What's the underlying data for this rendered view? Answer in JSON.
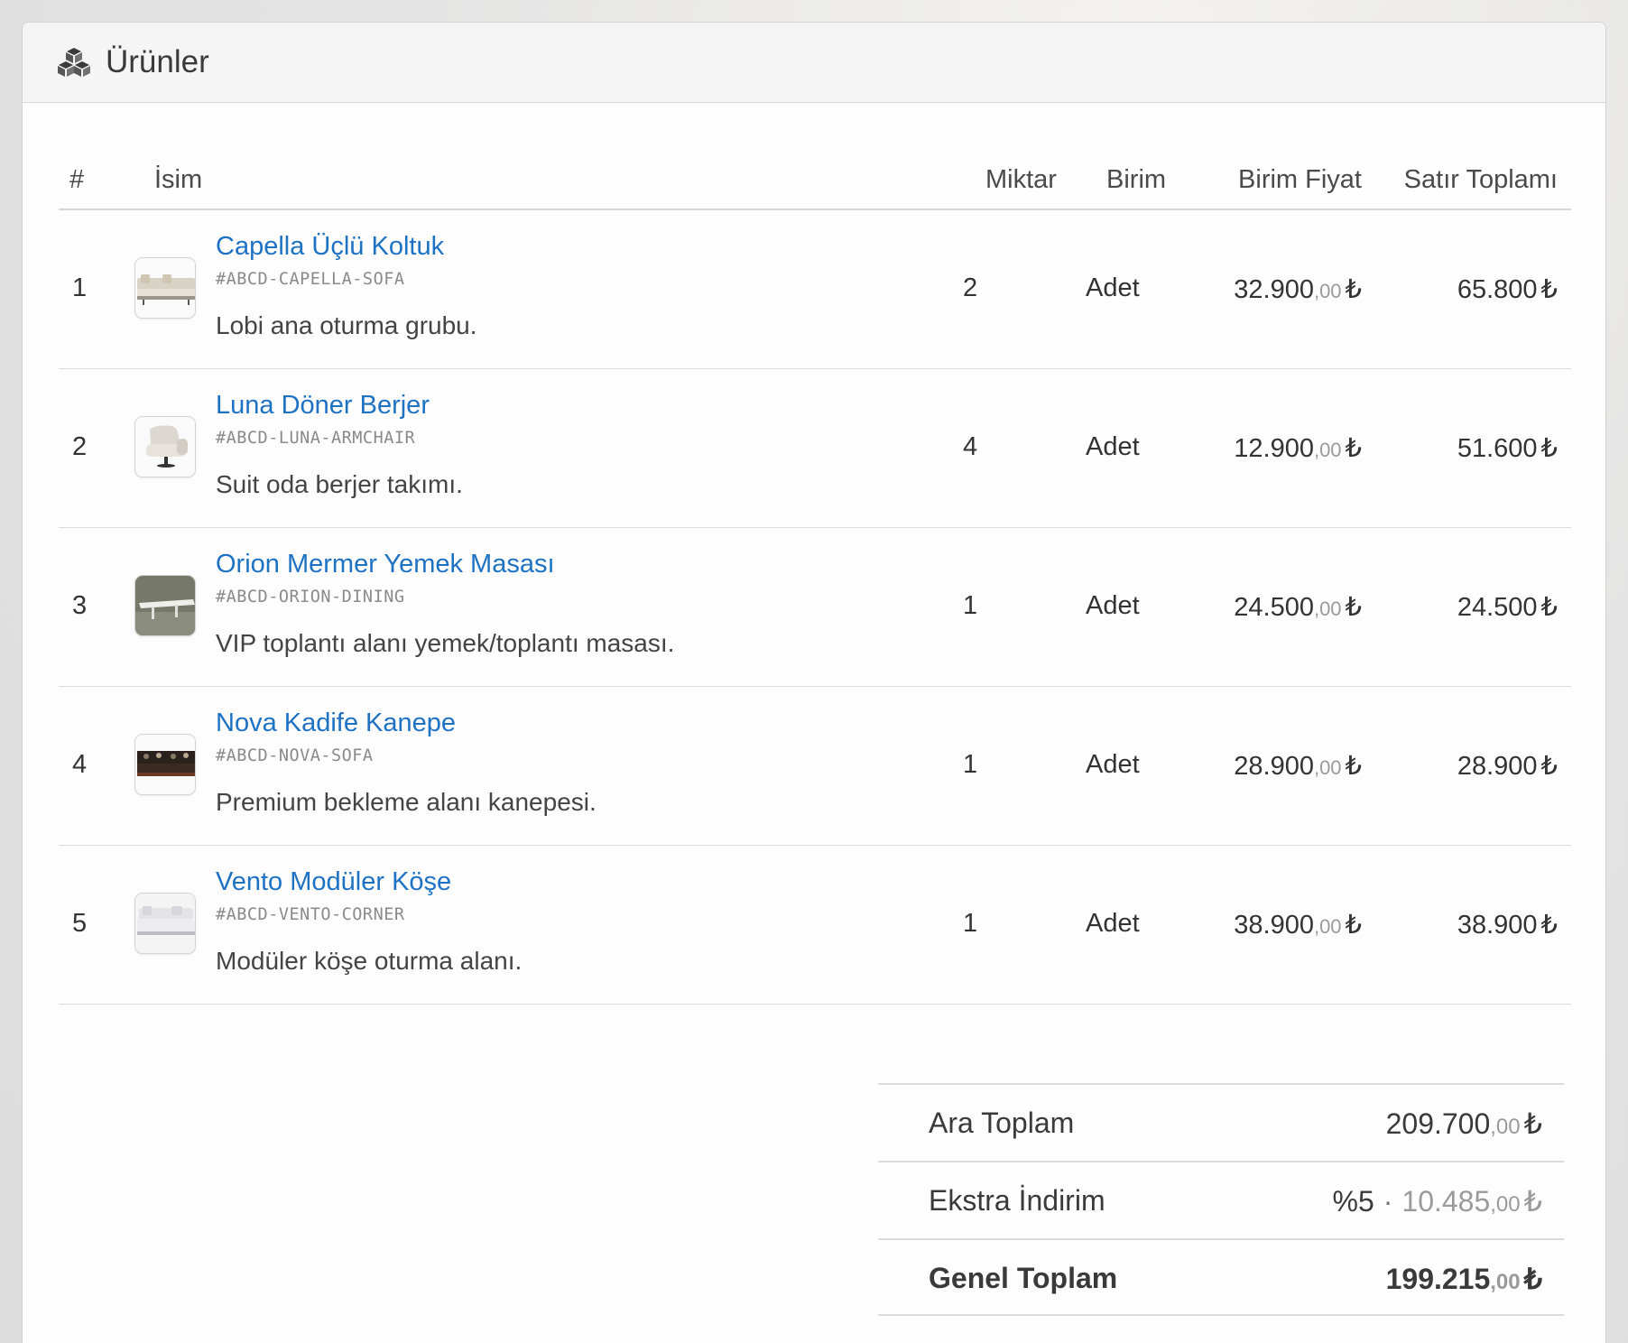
{
  "header": {
    "title": "Ürünler",
    "icon": "cubes-icon"
  },
  "table": {
    "columns": [
      "#",
      "İsim",
      "Miktar",
      "Birim",
      "Birim Fiyat",
      "Satır Toplamı"
    ],
    "rows": [
      {
        "num": "1",
        "name": "Capella Üçlü Koltuk",
        "sku": "#ABCD-CAPELLA-SOFA",
        "desc": "Lobi ana oturma grubu.",
        "qty": "2",
        "unit": "Adet",
        "unit_price_int": "32.900",
        "unit_price_dec": ",00",
        "currency": "₺",
        "line_total": "65.800"
      },
      {
        "num": "2",
        "name": "Luna Döner Berjer",
        "sku": "#ABCD-LUNA-ARMCHAIR",
        "desc": "Suit oda berjer takımı.",
        "qty": "4",
        "unit": "Adet",
        "unit_price_int": "12.900",
        "unit_price_dec": ",00",
        "currency": "₺",
        "line_total": "51.600"
      },
      {
        "num": "3",
        "name": "Orion Mermer Yemek Masası",
        "sku": "#ABCD-ORION-DINING",
        "desc": "VIP toplantı alanı yemek/toplantı masası.",
        "qty": "1",
        "unit": "Adet",
        "unit_price_int": "24.500",
        "unit_price_dec": ",00",
        "currency": "₺",
        "line_total": "24.500"
      },
      {
        "num": "4",
        "name": "Nova Kadife Kanepe",
        "sku": "#ABCD-NOVA-SOFA",
        "desc": "Premium bekleme alanı kanepesi.",
        "qty": "1",
        "unit": "Adet",
        "unit_price_int": "28.900",
        "unit_price_dec": ",00",
        "currency": "₺",
        "line_total": "28.900"
      },
      {
        "num": "5",
        "name": "Vento Modüler Köşe",
        "sku": "#ABCD-VENTO-CORNER",
        "desc": "Modüler köşe oturma alanı.",
        "qty": "1",
        "unit": "Adet",
        "unit_price_int": "38.900",
        "unit_price_dec": ",00",
        "currency": "₺",
        "line_total": "38.900"
      }
    ]
  },
  "summary": {
    "subtotal_label": "Ara Toplam",
    "subtotal_int": "209.700",
    "subtotal_dec": ",00",
    "discount_label": "Ekstra İndirim",
    "discount_rate": "%5",
    "discount_sep": "·",
    "discount_int": "10.485",
    "discount_dec": ",00",
    "total_label": "Genel Toplam",
    "total_int": "199.215",
    "total_dec": ",00",
    "currency": "₺"
  }
}
